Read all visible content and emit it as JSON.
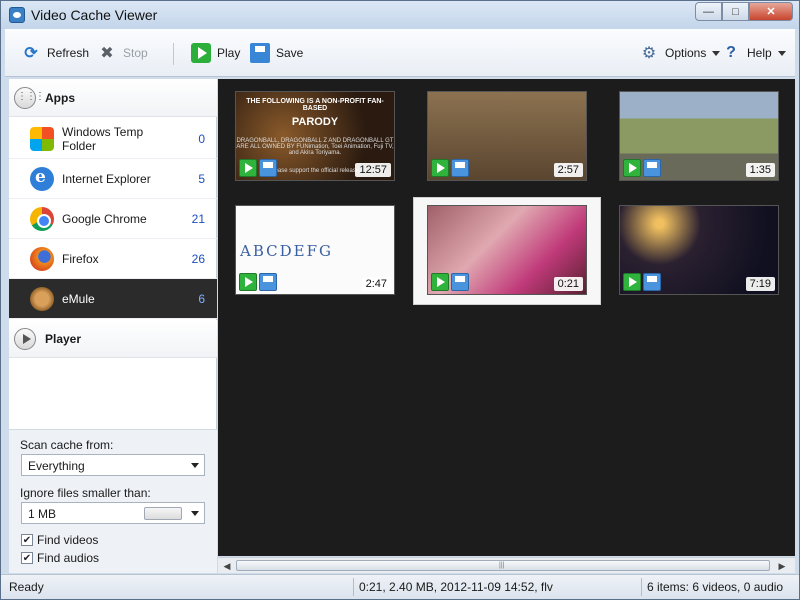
{
  "window": {
    "title": "Video Cache Viewer",
    "controls": {
      "minimize": "—",
      "maximize": "□",
      "close": "✕"
    }
  },
  "toolbar": {
    "refresh_label": "Refresh",
    "stop_label": "Stop",
    "play_label": "Play",
    "save_label": "Save",
    "options_label": "Options",
    "help_label": "Help"
  },
  "sidebar": {
    "apps_header": "Apps",
    "apps": [
      {
        "name": "Windows Temp Folder",
        "count": "0",
        "icon": "windows-icon"
      },
      {
        "name": "Internet Explorer",
        "count": "5",
        "icon": "internet-explorer-icon"
      },
      {
        "name": "Google Chrome",
        "count": "21",
        "icon": "chrome-icon"
      },
      {
        "name": "Firefox",
        "count": "26",
        "icon": "firefox-icon"
      },
      {
        "name": "eMule",
        "count": "6",
        "icon": "emule-icon",
        "selected": true
      }
    ],
    "player_header": "Player",
    "options": {
      "scan_label": "Scan cache from:",
      "scan_value": "Everything",
      "ignore_label": "Ignore files smaller than:",
      "ignore_value": "1 MB",
      "find_videos_label": "Find videos",
      "find_videos_checked": true,
      "find_audios_label": "Find audios",
      "find_audios_checked": true
    }
  },
  "videos": [
    {
      "duration": "12:57",
      "lines": [
        "THE FOLLOWING IS A NON-PROFIT FAN-BASED",
        "PARODY",
        "DRAGONBALL, DRAGONBALL Z AND DRAGONBALL GT ARE ALL OWNED BY FUNimation, Toei Animation, Fuji TV, and Akira Toriyama.",
        "Please support the official release."
      ]
    },
    {
      "duration": "2:57"
    },
    {
      "duration": "1:35"
    },
    {
      "duration": "2:47",
      "text": "ABCDEFG"
    },
    {
      "duration": "0:21",
      "selected": true
    },
    {
      "duration": "7:19"
    }
  ],
  "status": {
    "left": "Ready",
    "middle": "0:21,  2.40 MB,  2012-11-09 14:52,  flv",
    "right": "6 items: 6 videos, 0 audio"
  },
  "colors": {
    "content_bg": "#1c1c1c",
    "selection_bg": "#2b2b2b",
    "count_text": "#1b4fbf",
    "play_green": "#2fb33d",
    "save_blue": "#4a93dd"
  }
}
